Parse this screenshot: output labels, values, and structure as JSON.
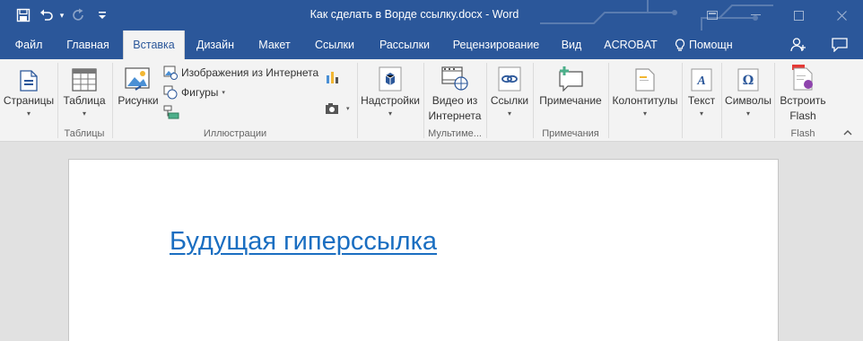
{
  "window": {
    "title": "Как сделать в Ворде ссылку.docx - Word"
  },
  "quick_access": {
    "icons": [
      "save-icon",
      "undo-icon",
      "redo-icon",
      "customize-qat-icon"
    ]
  },
  "tabs": [
    {
      "label": "Файл"
    },
    {
      "label": "Главная"
    },
    {
      "label": "Вставка",
      "active": true
    },
    {
      "label": "Дизайн"
    },
    {
      "label": "Макет"
    },
    {
      "label": "Ссылки"
    },
    {
      "label": "Рассылки"
    },
    {
      "label": "Рецензирование"
    },
    {
      "label": "Вид"
    },
    {
      "label": "ACROBAT"
    },
    {
      "label": "Помощн"
    }
  ],
  "ribbon": {
    "pages": {
      "label": "Страницы"
    },
    "tables": {
      "label": "Таблица",
      "group": "Таблицы"
    },
    "illustrations": {
      "group": "Иллюстрации",
      "pictures": "Рисунки",
      "online_pictures": "Изображения из Интернета",
      "shapes": "Фигуры"
    },
    "addins": {
      "label": "Надстройки"
    },
    "media": {
      "video_line1": "Видео из",
      "video_line2": "Интернета",
      "group": "Мультиме..."
    },
    "links": {
      "label": "Ссылки"
    },
    "comments": {
      "label": "Примечание",
      "group": "Примечания"
    },
    "header_footer": {
      "label": "Колонтитулы"
    },
    "text": {
      "label": "Текст"
    },
    "symbols": {
      "label": "Символы"
    },
    "flash": {
      "line1": "Встроить",
      "line2": "Flash",
      "group": "Flash"
    }
  },
  "document": {
    "hyperlink_text": "Будущая гиперссылка"
  },
  "colors": {
    "brand": "#2b579a",
    "hyperlink": "#1a6ec1",
    "ribbon_bg": "#f3f3f3"
  }
}
